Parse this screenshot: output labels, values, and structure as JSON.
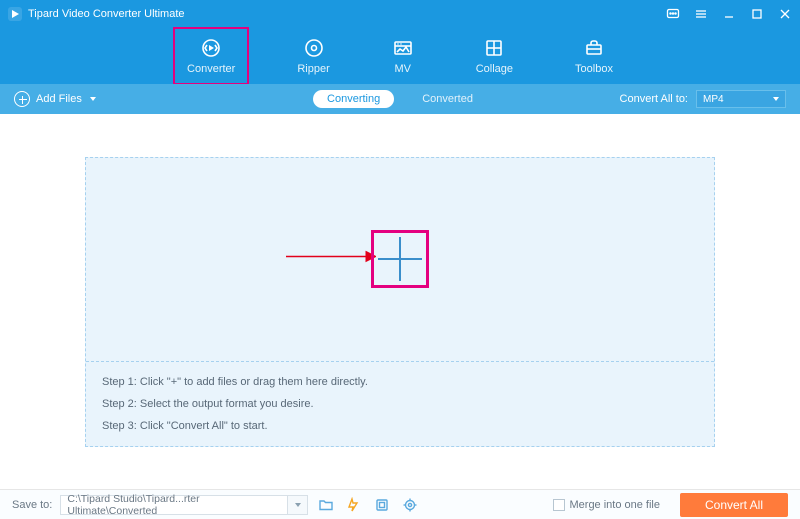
{
  "titlebar": {
    "title": "Tipard Video Converter Ultimate"
  },
  "tabs": {
    "converter": "Converter",
    "ripper": "Ripper",
    "mv": "MV",
    "collage": "Collage",
    "toolbox": "Toolbox"
  },
  "toolbar": {
    "add_files": "Add Files",
    "converting": "Converting",
    "converted": "Converted",
    "convert_all_to": "Convert All to:",
    "format": "MP4"
  },
  "steps": {
    "s1": "Step 1: Click \"+\" to add files or drag them here directly.",
    "s2": "Step 2: Select the output format you desire.",
    "s3": "Step 3: Click \"Convert All\" to start."
  },
  "footer": {
    "save_to": "Save to:",
    "path": "C:\\Tipard Studio\\Tipard...rter Ultimate\\Converted",
    "merge": "Merge into one file",
    "convert_all": "Convert All"
  }
}
